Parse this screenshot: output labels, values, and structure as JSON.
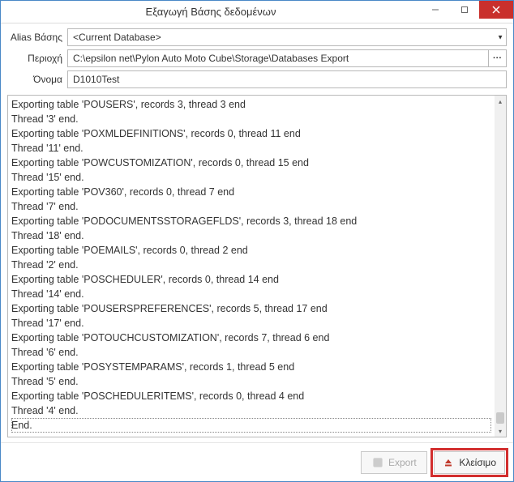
{
  "window": {
    "title": "Εξαγωγή Βάσης δεδομένων"
  },
  "form": {
    "alias_label": "Alias Βάσης",
    "alias_value": "<Current Database>",
    "region_label": "Περιοχή",
    "region_value": "C:\\epsilon net\\Pylon Auto Moto Cube\\Storage\\Databases Export",
    "name_label": "Όνομα",
    "name_value": "D1010Test"
  },
  "log": [
    "Exporting table 'POUSERS', records 3, thread 3 end",
    "Thread '3' end.",
    "Exporting table 'POXMLDEFINITIONS', records 0, thread 11 end",
    "Thread '11' end.",
    "Exporting table 'POWCUSTOMIZATION', records 0, thread 15 end",
    "Thread '15' end.",
    "Exporting table 'POV360', records 0, thread 7 end",
    "Thread '7' end.",
    "Exporting table 'PODOCUMENTSSTORAGEFLDS', records 3, thread 18 end",
    "Thread '18' end.",
    "Exporting table 'POEMAILS', records 0, thread 2 end",
    "Thread '2' end.",
    "Exporting table 'POSCHEDULER', records 0, thread 14 end",
    "Thread '14' end.",
    "Exporting table 'POUSERSPREFERENCES', records 5, thread 17 end",
    "Thread '17' end.",
    "Exporting table 'POTOUCHCUSTOMIZATION', records 7, thread 6 end",
    "Thread '6' end.",
    "Exporting table 'POSYSTEMPARAMS', records 1, thread 5 end",
    "Thread '5' end.",
    "Exporting table 'POSCHEDULERITEMS', records 0, thread 4 end",
    "Thread '4' end.",
    "End."
  ],
  "buttons": {
    "export": "Export",
    "close": "Κλείσιμο"
  }
}
